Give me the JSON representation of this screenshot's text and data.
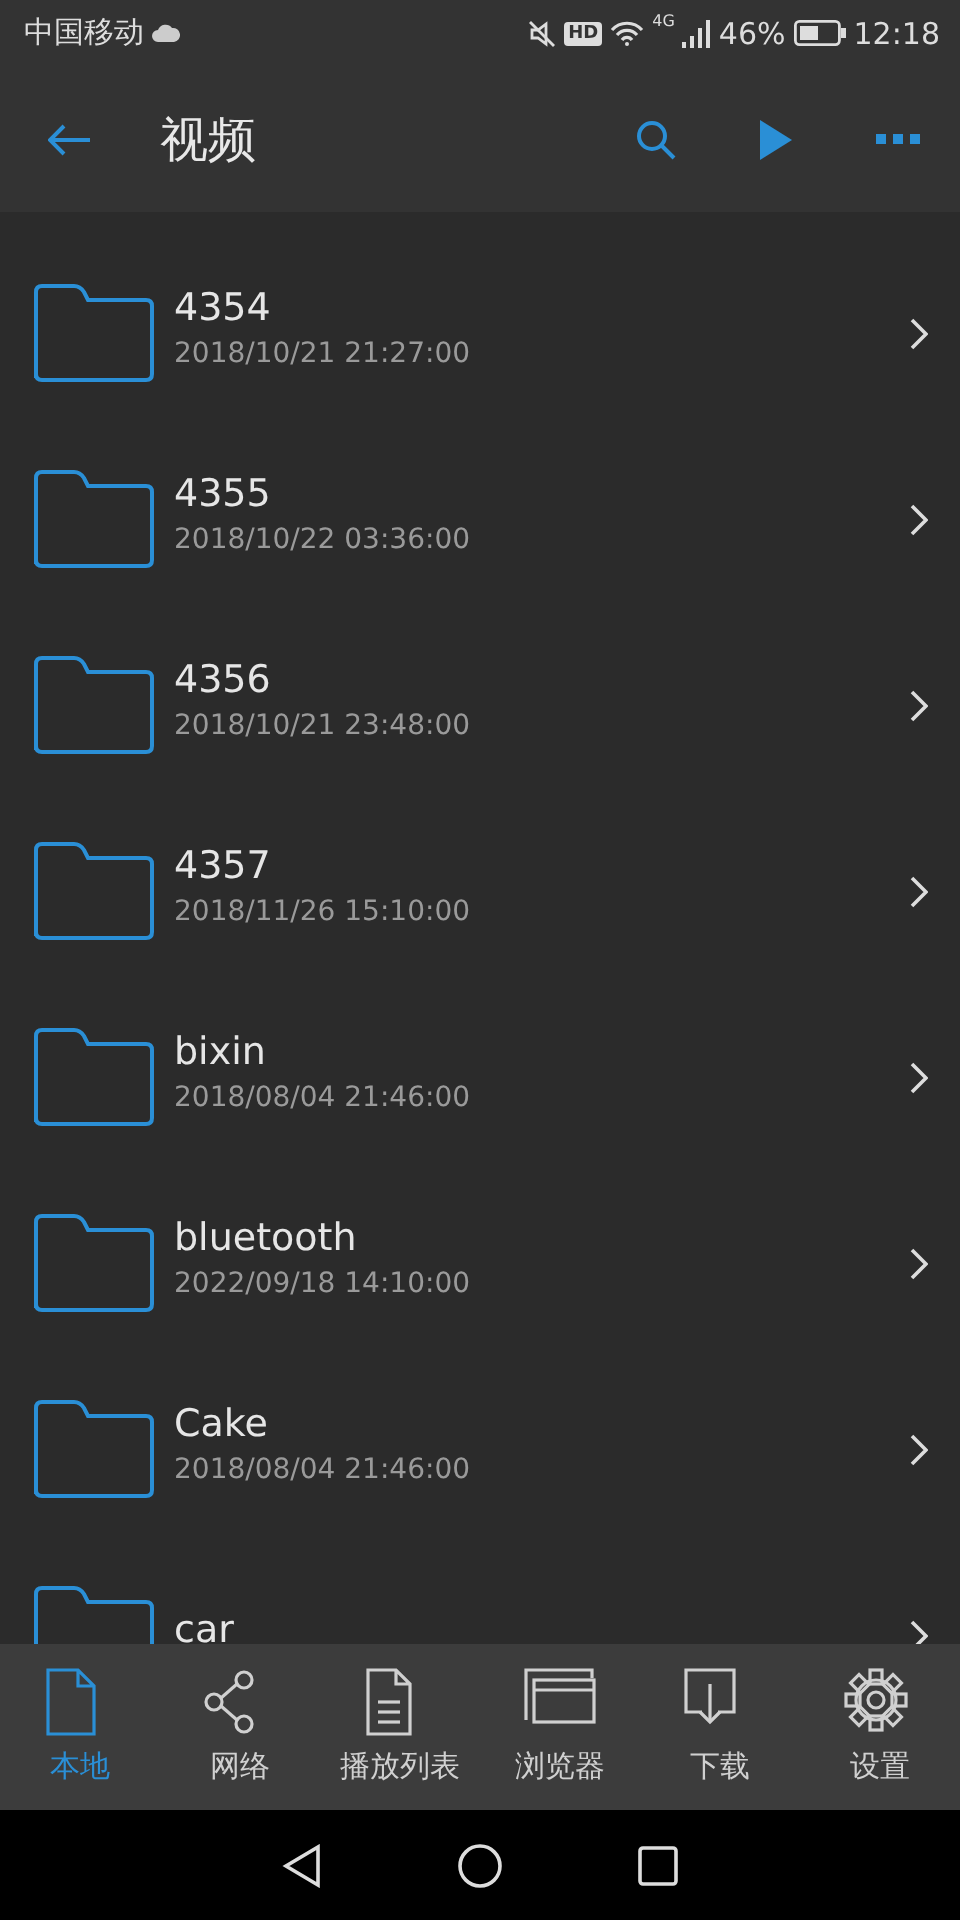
{
  "status_bar": {
    "carrier": "中国移动",
    "hd_badge": "HD",
    "network": "4G",
    "battery": "46%",
    "time": "12:18"
  },
  "toolbar": {
    "title": "视频"
  },
  "folders": [
    {
      "name": "4354",
      "date": "2018/10/21 21:27:00"
    },
    {
      "name": "4355",
      "date": "2018/10/22 03:36:00"
    },
    {
      "name": "4356",
      "date": "2018/10/21 23:48:00"
    },
    {
      "name": "4357",
      "date": "2018/11/26 15:10:00"
    },
    {
      "name": "bixin",
      "date": "2018/08/04 21:46:00"
    },
    {
      "name": "bluetooth",
      "date": "2022/09/18 14:10:00"
    },
    {
      "name": "Cake",
      "date": "2018/08/04 21:46:00"
    },
    {
      "name": "car"
    }
  ],
  "bottom_nav": [
    {
      "label": "本地",
      "selected": true
    },
    {
      "label": "网络",
      "selected": false
    },
    {
      "label": "播放列表",
      "selected": false
    },
    {
      "label": "浏览器",
      "selected": false
    },
    {
      "label": "下载",
      "selected": false
    },
    {
      "label": "设置",
      "selected": false
    }
  ]
}
